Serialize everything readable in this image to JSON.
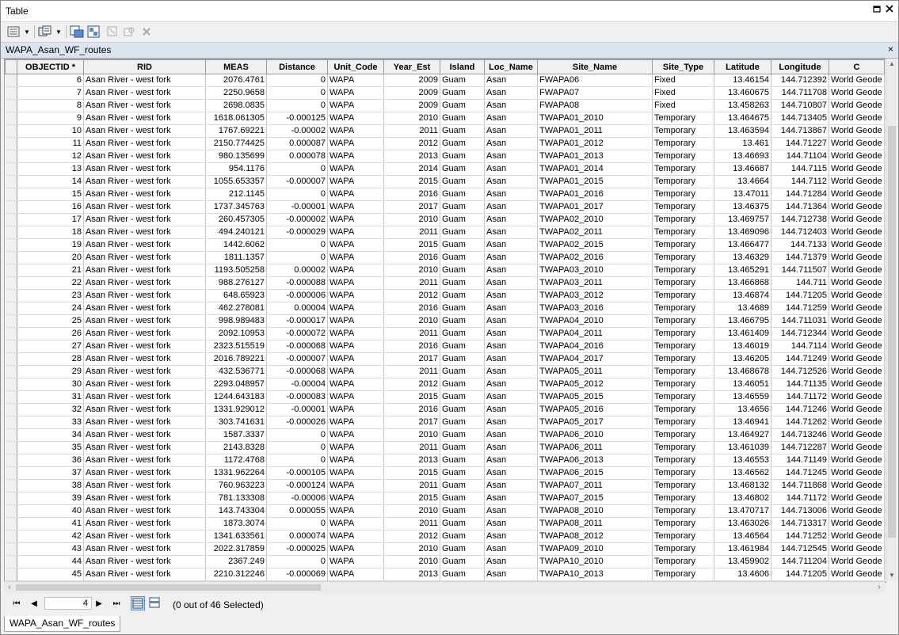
{
  "window": {
    "title": "Table",
    "restore_icon": "restore-icon",
    "close_icon": "close-icon"
  },
  "toolbar": {
    "items": [
      "table-options-icon",
      "dropdown-arrow-icon",
      "related-tables-icon",
      "dropdown-arrow-icon",
      "select-by-attributes-icon",
      "switch-selection-icon",
      "clear-selection-icon",
      "zoom-to-selected-icon",
      "delete-selected-icon"
    ]
  },
  "tab": {
    "label": "WAPA_Asan_WF_routes",
    "close": "×"
  },
  "columns": [
    "OBJECTID *",
    "RID",
    "MEAS",
    "Distance",
    "Unit_Code",
    "Year_Est",
    "Island",
    "Loc_Name",
    "Site_Name",
    "Site_Type",
    "Latitude",
    "Longitude",
    "C"
  ],
  "rows": [
    [
      "6",
      "Asan River - west fork",
      "2076.4761",
      "0",
      "WAPA",
      "2009",
      "Guam",
      "Asan",
      "FWAPA06",
      "Fixed",
      "13.46154",
      "144.712392",
      "World Geode"
    ],
    [
      "7",
      "Asan River - west fork",
      "2250.9658",
      "0",
      "WAPA",
      "2009",
      "Guam",
      "Asan",
      "FWAPA07",
      "Fixed",
      "13.460675",
      "144.711708",
      "World Geode"
    ],
    [
      "8",
      "Asan River - west fork",
      "2698.0835",
      "0",
      "WAPA",
      "2009",
      "Guam",
      "Asan",
      "FWAPA08",
      "Fixed",
      "13.458263",
      "144.710807",
      "World Geode"
    ],
    [
      "9",
      "Asan River - west fork",
      "1618.061305",
      "-0.000125",
      "WAPA",
      "2010",
      "Guam",
      "Asan",
      "TWAPA01_2010",
      "Temporary",
      "13.464675",
      "144.713405",
      "World Geode"
    ],
    [
      "10",
      "Asan River - west fork",
      "1767.69221",
      "-0.00002",
      "WAPA",
      "2011",
      "Guam",
      "Asan",
      "TWAPA01_2011",
      "Temporary",
      "13.463594",
      "144.713867",
      "World Geode"
    ],
    [
      "11",
      "Asan River - west fork",
      "2150.774425",
      "0.000087",
      "WAPA",
      "2012",
      "Guam",
      "Asan",
      "TWAPA01_2012",
      "Temporary",
      "13.461",
      "144.71227",
      "World Geode"
    ],
    [
      "12",
      "Asan River - west fork",
      "980.135699",
      "0.000078",
      "WAPA",
      "2013",
      "Guam",
      "Asan",
      "TWAPA01_2013",
      "Temporary",
      "13.46693",
      "144.71104",
      "World Geode"
    ],
    [
      "13",
      "Asan River - west fork",
      "954.1176",
      "0",
      "WAPA",
      "2014",
      "Guam",
      "Asan",
      "TWAPA01_2014",
      "Temporary",
      "13.46687",
      "144.7115",
      "World Geode"
    ],
    [
      "14",
      "Asan River - west fork",
      "1055.653357",
      "-0.000007",
      "WAPA",
      "2015",
      "Guam",
      "Asan",
      "TWAPA01_2015",
      "Temporary",
      "13.4664",
      "144.7112",
      "World Geode"
    ],
    [
      "15",
      "Asan River - west fork",
      "212.1145",
      "0",
      "WAPA",
      "2016",
      "Guam",
      "Asan",
      "TWAPA01_2016",
      "Temporary",
      "13.47011",
      "144.71284",
      "World Geode"
    ],
    [
      "16",
      "Asan River - west fork",
      "1737.345763",
      "-0.00001",
      "WAPA",
      "2017",
      "Guam",
      "Asan",
      "TWAPA01_2017",
      "Temporary",
      "13.46375",
      "144.71364",
      "World Geode"
    ],
    [
      "17",
      "Asan River - west fork",
      "260.457305",
      "-0.000002",
      "WAPA",
      "2010",
      "Guam",
      "Asan",
      "TWAPA02_2010",
      "Temporary",
      "13.469757",
      "144.712738",
      "World Geode"
    ],
    [
      "18",
      "Asan River - west fork",
      "494.240121",
      "-0.000029",
      "WAPA",
      "2011",
      "Guam",
      "Asan",
      "TWAPA02_2011",
      "Temporary",
      "13.469096",
      "144.712403",
      "World Geode"
    ],
    [
      "19",
      "Asan River - west fork",
      "1442.6062",
      "0",
      "WAPA",
      "2015",
      "Guam",
      "Asan",
      "TWAPA02_2015",
      "Temporary",
      "13.466477",
      "144.7133",
      "World Geode"
    ],
    [
      "20",
      "Asan River - west fork",
      "1811.1357",
      "0",
      "WAPA",
      "2016",
      "Guam",
      "Asan",
      "TWAPA02_2016",
      "Temporary",
      "13.46329",
      "144.71379",
      "World Geode"
    ],
    [
      "21",
      "Asan River - west fork",
      "1193.505258",
      "0.00002",
      "WAPA",
      "2010",
      "Guam",
      "Asan",
      "TWAPA03_2010",
      "Temporary",
      "13.465291",
      "144.711507",
      "World Geode"
    ],
    [
      "22",
      "Asan River - west fork",
      "988.276127",
      "-0.000088",
      "WAPA",
      "2011",
      "Guam",
      "Asan",
      "TWAPA03_2011",
      "Temporary",
      "13.466868",
      "144.711",
      "World Geode"
    ],
    [
      "23",
      "Asan River - west fork",
      "648.65923",
      "-0.000006",
      "WAPA",
      "2012",
      "Guam",
      "Asan",
      "TWAPA03_2012",
      "Temporary",
      "13.46874",
      "144.71205",
      "World Geode"
    ],
    [
      "24",
      "Asan River - west fork",
      "462.278081",
      "0.00004",
      "WAPA",
      "2016",
      "Guam",
      "Asan",
      "TWAPA03_2016",
      "Temporary",
      "13.4689",
      "144.71259",
      "World Geode"
    ],
    [
      "25",
      "Asan River - west fork",
      "998.989483",
      "-0.000017",
      "WAPA",
      "2010",
      "Guam",
      "Asan",
      "TWAPA04_2010",
      "Temporary",
      "13.466795",
      "144.711031",
      "World Geode"
    ],
    [
      "26",
      "Asan River - west fork",
      "2092.10953",
      "-0.000072",
      "WAPA",
      "2011",
      "Guam",
      "Asan",
      "TWAPA04_2011",
      "Temporary",
      "13.461409",
      "144.712344",
      "World Geode"
    ],
    [
      "27",
      "Asan River - west fork",
      "2323.515519",
      "-0.000068",
      "WAPA",
      "2016",
      "Guam",
      "Asan",
      "TWAPA04_2016",
      "Temporary",
      "13.46019",
      "144.7114",
      "World Geode"
    ],
    [
      "28",
      "Asan River - west fork",
      "2016.789221",
      "-0.000007",
      "WAPA",
      "2017",
      "Guam",
      "Asan",
      "TWAPA04_2017",
      "Temporary",
      "13.46205",
      "144.71249",
      "World Geode"
    ],
    [
      "29",
      "Asan River - west fork",
      "432.536771",
      "-0.000068",
      "WAPA",
      "2011",
      "Guam",
      "Asan",
      "TWAPA05_2011",
      "Temporary",
      "13.468678",
      "144.712526",
      "World Geode"
    ],
    [
      "30",
      "Asan River - west fork",
      "2293.048957",
      "-0.00004",
      "WAPA",
      "2012",
      "Guam",
      "Asan",
      "TWAPA05_2012",
      "Temporary",
      "13.46051",
      "144.71135",
      "World Geode"
    ],
    [
      "31",
      "Asan River - west fork",
      "1244.643183",
      "-0.000083",
      "WAPA",
      "2015",
      "Guam",
      "Asan",
      "TWAPA05_2015",
      "Temporary",
      "13.46559",
      "144.71172",
      "World Geode"
    ],
    [
      "32",
      "Asan River - west fork",
      "1331.929012",
      "-0.00001",
      "WAPA",
      "2016",
      "Guam",
      "Asan",
      "TWAPA05_2016",
      "Temporary",
      "13.4656",
      "144.71246",
      "World Geode"
    ],
    [
      "33",
      "Asan River - west fork",
      "303.741631",
      "-0.000026",
      "WAPA",
      "2017",
      "Guam",
      "Asan",
      "TWAPA05_2017",
      "Temporary",
      "13.46941",
      "144.71262",
      "World Geode"
    ],
    [
      "34",
      "Asan River - west fork",
      "1587.3337",
      "0",
      "WAPA",
      "2010",
      "Guam",
      "Asan",
      "TWAPA06_2010",
      "Temporary",
      "13.464927",
      "144.713246",
      "World Geode"
    ],
    [
      "35",
      "Asan River - west fork",
      "2143.8328",
      "0",
      "WAPA",
      "2011",
      "Guam",
      "Asan",
      "TWAPA06_2011",
      "Temporary",
      "13.461039",
      "144.712287",
      "World Geode"
    ],
    [
      "36",
      "Asan River - west fork",
      "1172.4768",
      "0",
      "WAPA",
      "2013",
      "Guam",
      "Asan",
      "TWAPA06_2013",
      "Temporary",
      "13.46553",
      "144.71149",
      "World Geode"
    ],
    [
      "37",
      "Asan River - west fork",
      "1331.962264",
      "-0.000105",
      "WAPA",
      "2015",
      "Guam",
      "Asan",
      "TWAPA06_2015",
      "Temporary",
      "13.46562",
      "144.71245",
      "World Geode"
    ],
    [
      "38",
      "Asan River - west fork",
      "760.963223",
      "-0.000124",
      "WAPA",
      "2011",
      "Guam",
      "Asan",
      "TWAPA07_2011",
      "Temporary",
      "13.468132",
      "144.711868",
      "World Geode"
    ],
    [
      "39",
      "Asan River - west fork",
      "781.133308",
      "-0.00006",
      "WAPA",
      "2015",
      "Guam",
      "Asan",
      "TWAPA07_2015",
      "Temporary",
      "13.46802",
      "144.71172",
      "World Geode"
    ],
    [
      "40",
      "Asan River - west fork",
      "143.743304",
      "0.000055",
      "WAPA",
      "2010",
      "Guam",
      "Asan",
      "TWAPA08_2010",
      "Temporary",
      "13.470717",
      "144.713006",
      "World Geode"
    ],
    [
      "41",
      "Asan River - west fork",
      "1873.3074",
      "0",
      "WAPA",
      "2011",
      "Guam",
      "Asan",
      "TWAPA08_2011",
      "Temporary",
      "13.463026",
      "144.713317",
      "World Geode"
    ],
    [
      "42",
      "Asan River - west fork",
      "1341.633561",
      "0.000074",
      "WAPA",
      "2012",
      "Guam",
      "Asan",
      "TWAPA08_2012",
      "Temporary",
      "13.46564",
      "144.71252",
      "World Geode"
    ],
    [
      "43",
      "Asan River - west fork",
      "2022.317859",
      "-0.000025",
      "WAPA",
      "2010",
      "Guam",
      "Asan",
      "TWAPA09_2010",
      "Temporary",
      "13.461984",
      "144.712545",
      "World Geode"
    ],
    [
      "44",
      "Asan River - west fork",
      "2367.249",
      "0",
      "WAPA",
      "2010",
      "Guam",
      "Asan",
      "TWAPA10_2010",
      "Temporary",
      "13.459902",
      "144.711204",
      "World Geode"
    ],
    [
      "45",
      "Asan River - west fork",
      "2210.312246",
      "-0.000069",
      "WAPA",
      "2013",
      "Guam",
      "Asan",
      "TWAPA10_2013",
      "Temporary",
      "13.4606",
      "144.71205",
      "World Geode"
    ]
  ],
  "nav": {
    "first": "⏮",
    "prev": "◀",
    "next": "▶",
    "last": "⏭",
    "record": "4",
    "status": "(0 out of 46 Selected)"
  },
  "bottom_tab": {
    "label": "WAPA_Asan_WF_routes"
  }
}
